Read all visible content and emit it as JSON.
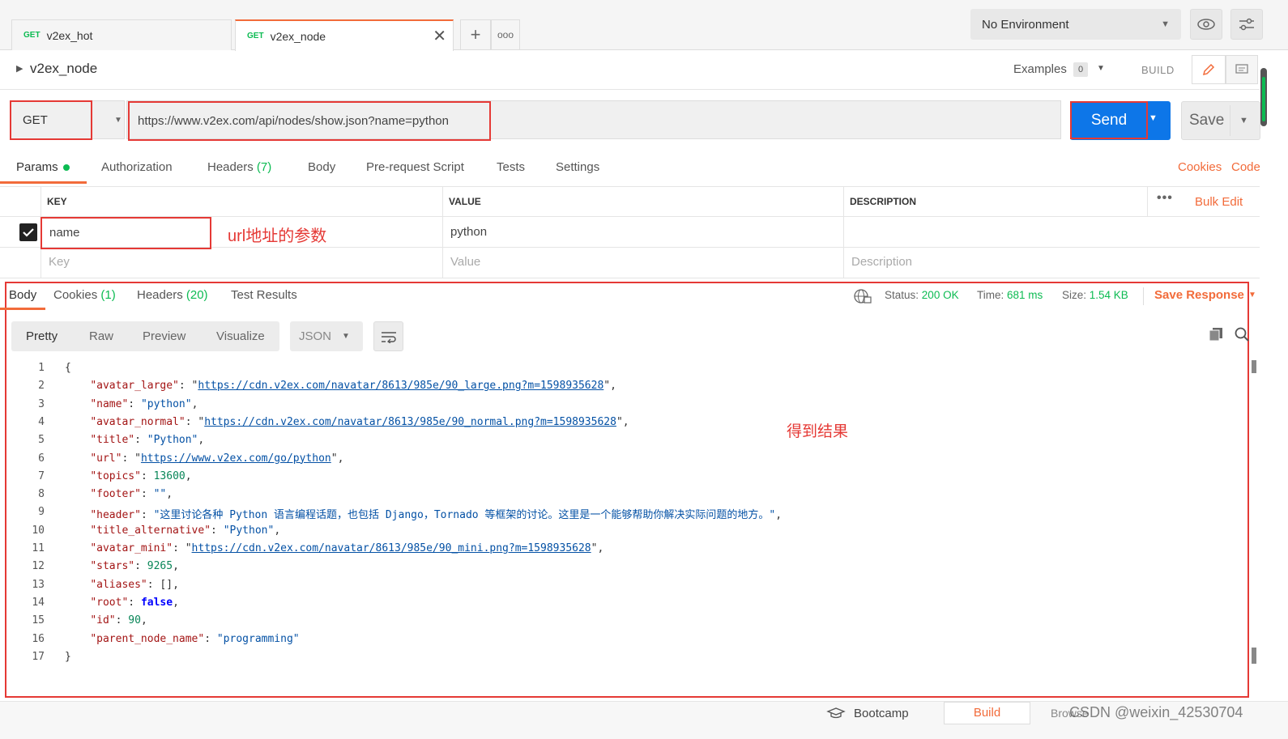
{
  "tabs": [
    {
      "method": "GET",
      "name": "v2ex_hot"
    },
    {
      "method": "GET",
      "name": "v2ex_node"
    }
  ],
  "env": {
    "selected": "No Environment"
  },
  "request": {
    "title": "v2ex_node",
    "examples_label": "Examples",
    "examples_count": "0",
    "build_label": "BUILD",
    "method": "GET",
    "url": "https://www.v2ex.com/api/nodes/show.json?name=python",
    "send_label": "Send",
    "save_label": "Save"
  },
  "param_tabs": {
    "params": "Params",
    "auth": "Authorization",
    "headers": "Headers",
    "headers_count": "(7)",
    "body": "Body",
    "prerequest": "Pre-request Script",
    "tests": "Tests",
    "settings": "Settings",
    "cookies": "Cookies",
    "code": "Code"
  },
  "params_table": {
    "key_header": "KEY",
    "value_header": "VALUE",
    "desc_header": "DESCRIPTION",
    "bulk_edit": "Bulk Edit",
    "row_key": "name",
    "row_value": "python",
    "key_ph": "Key",
    "value_ph": "Value",
    "desc_ph": "Description"
  },
  "annotations": {
    "url_params": "url地址的参数",
    "result": "得到结果"
  },
  "response": {
    "body": "Body",
    "cookies": "Cookies",
    "cookies_count": "(1)",
    "headers": "Headers",
    "headers_count": "(20)",
    "test_results": "Test Results",
    "status_label": "Status:",
    "status": "200 OK",
    "time_label": "Time:",
    "time": "681 ms",
    "size_label": "Size:",
    "size": "1.54 KB",
    "save_response": "Save Response"
  },
  "view_tabs": {
    "pretty": "Pretty",
    "raw": "Raw",
    "preview": "Preview",
    "visualize": "Visualize",
    "format": "JSON"
  },
  "json": [
    {
      "t": "p",
      "v": "{"
    },
    {
      "t": "kv",
      "k": "\"avatar_large\"",
      "v": "https://cdn.v2ex.com/navatar/8613/985e/90_large.png?m=1598935628",
      "vt": "url"
    },
    {
      "t": "kv",
      "k": "\"name\"",
      "v": "\"python\"",
      "vt": "s"
    },
    {
      "t": "kv",
      "k": "\"avatar_normal\"",
      "v": "https://cdn.v2ex.com/navatar/8613/985e/90_normal.png?m=1598935628",
      "vt": "url"
    },
    {
      "t": "kv",
      "k": "\"title\"",
      "v": "\"Python\"",
      "vt": "s"
    },
    {
      "t": "kv",
      "k": "\"url\"",
      "v": "https://www.v2ex.com/go/python",
      "vt": "url"
    },
    {
      "t": "kv",
      "k": "\"topics\"",
      "v": "13600",
      "vt": "n"
    },
    {
      "t": "kv",
      "k": "\"footer\"",
      "v": "\"\"",
      "vt": "s"
    },
    {
      "t": "kv",
      "k": "\"header\"",
      "v": "\"这里讨论各种 Python 语言编程话题，也包括 Django，Tornado 等框架的讨论。这里是一个能够帮助你解决实际问题的地方。\"",
      "vt": "s"
    },
    {
      "t": "kv",
      "k": "\"title_alternative\"",
      "v": "\"Python\"",
      "vt": "s"
    },
    {
      "t": "kv",
      "k": "\"avatar_mini\"",
      "v": "https://cdn.v2ex.com/navatar/8613/985e/90_mini.png?m=1598935628",
      "vt": "url"
    },
    {
      "t": "kv",
      "k": "\"stars\"",
      "v": "9265",
      "vt": "n"
    },
    {
      "t": "kv",
      "k": "\"aliases\"",
      "v": "[]",
      "vt": "p"
    },
    {
      "t": "kv",
      "k": "\"root\"",
      "v": "false",
      "vt": "b"
    },
    {
      "t": "kv",
      "k": "\"id\"",
      "v": "90",
      "vt": "n"
    },
    {
      "t": "kv",
      "k": "\"parent_node_name\"",
      "v": "\"programming\"",
      "vt": "s",
      "last": true
    },
    {
      "t": "p",
      "v": "}"
    }
  ],
  "footer": {
    "bootcamp": "Bootcamp",
    "build": "Build",
    "browse": "Browse",
    "watermark": "CSDN @weixin_42530704"
  }
}
